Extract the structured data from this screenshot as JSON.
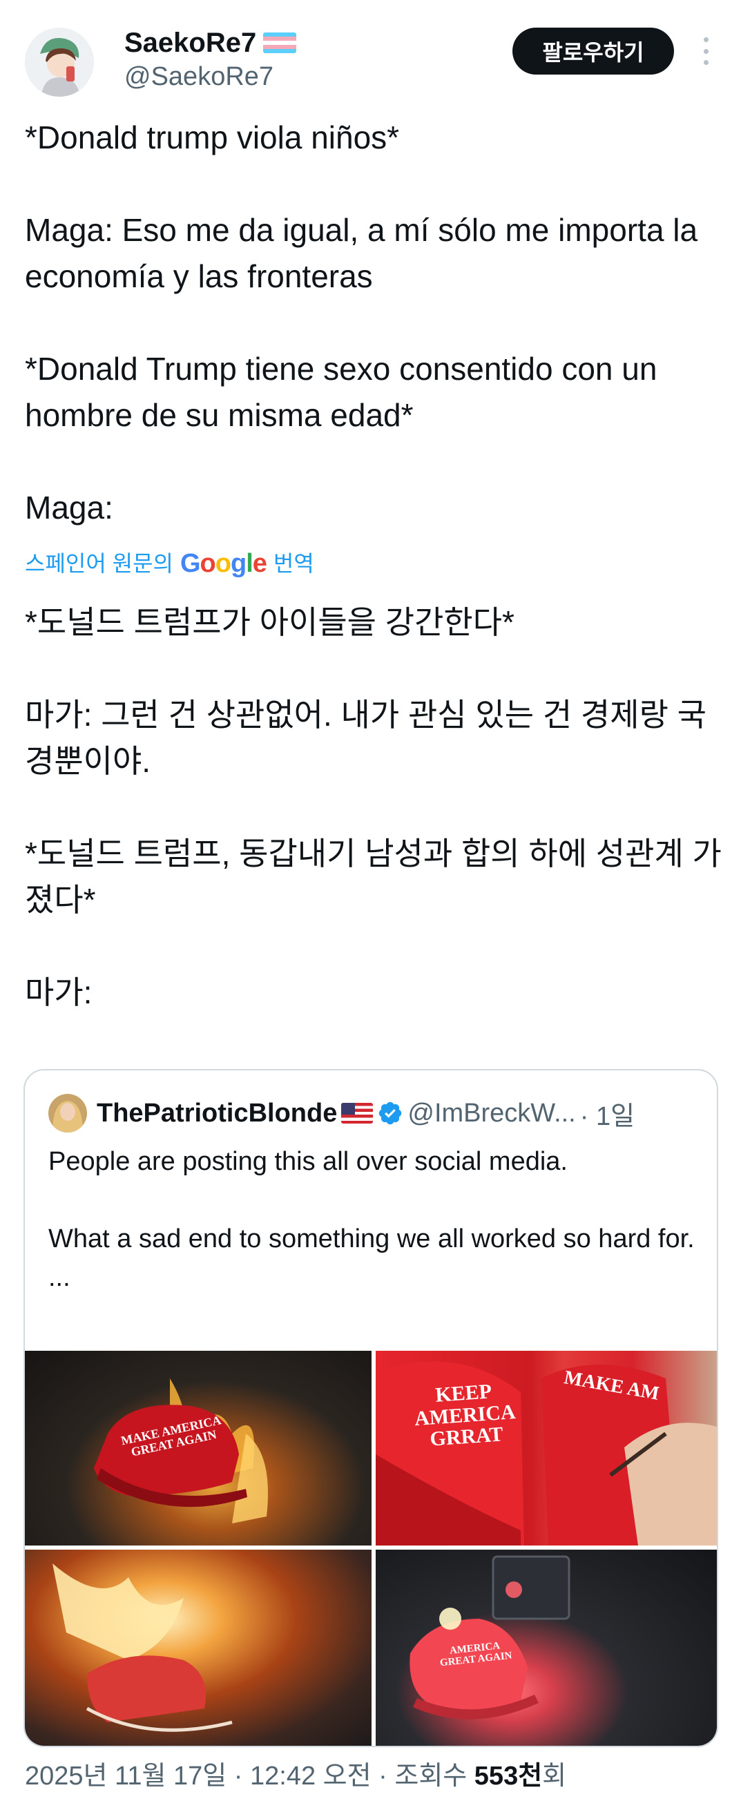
{
  "author": {
    "display_name": "SaekoRe7",
    "handle": "@SaekoRe7",
    "flag_icon": "transgender-flag-icon",
    "follow_label": "팔로우하기"
  },
  "tweet": {
    "original_text": "*Donald trump viola niños*\n\nMaga: Eso me da igual, a mí sólo me importa la economía y las fronteras\n\n*Donald Trump tiene sexo consentido con un hombre de su misma edad*\n\nMaga:",
    "translation": {
      "prefix": "스페인어 원문의",
      "google": "Google",
      "suffix": "번역"
    },
    "translated_text": "*도널드 트럼프가 아이들을 강간한다*\n\n마가: 그런 건 상관없어. 내가 관심 있는 건 경제랑 국경뿐이야.\n\n*도널드 트럼프, 동갑내기 남성과 합의 하에 성관계 가졌다*\n\n마가:"
  },
  "quote": {
    "display_name": "ThePatrioticBlonde",
    "flag_icon": "us-flag-icon",
    "verified_icon": "verified-badge-icon",
    "handle": "@ImBreckW...",
    "time": "· 1일",
    "text": "People are posting this all over social media.\n\nWhat a sad end to something we all worked so hard for.\n...",
    "media": [
      {
        "icon": "burning-hat-photo",
        "caption": "MAKE AMERICA\nGREAT AGAIN"
      },
      {
        "icon": "red-hats-photo",
        "caption": "KEEP\nAMERICA\nGRRAT",
        "caption2": "MAKE AM"
      },
      {
        "icon": "burning-hat-photo-2",
        "caption": ""
      },
      {
        "icon": "hat-at-night-photo",
        "caption": "AMERICA\nGREAT AGAIN"
      }
    ]
  },
  "footer": {
    "date": "2025년 11월 17일 · 12:42 오전 · 조회수 ",
    "views": "553천",
    "views_suffix": "회"
  },
  "colors": {
    "accent": "#1d9bf0",
    "text": "#0f1419",
    "muted": "#536471",
    "border": "#cfd9de",
    "button_bg": "#0f1419"
  }
}
